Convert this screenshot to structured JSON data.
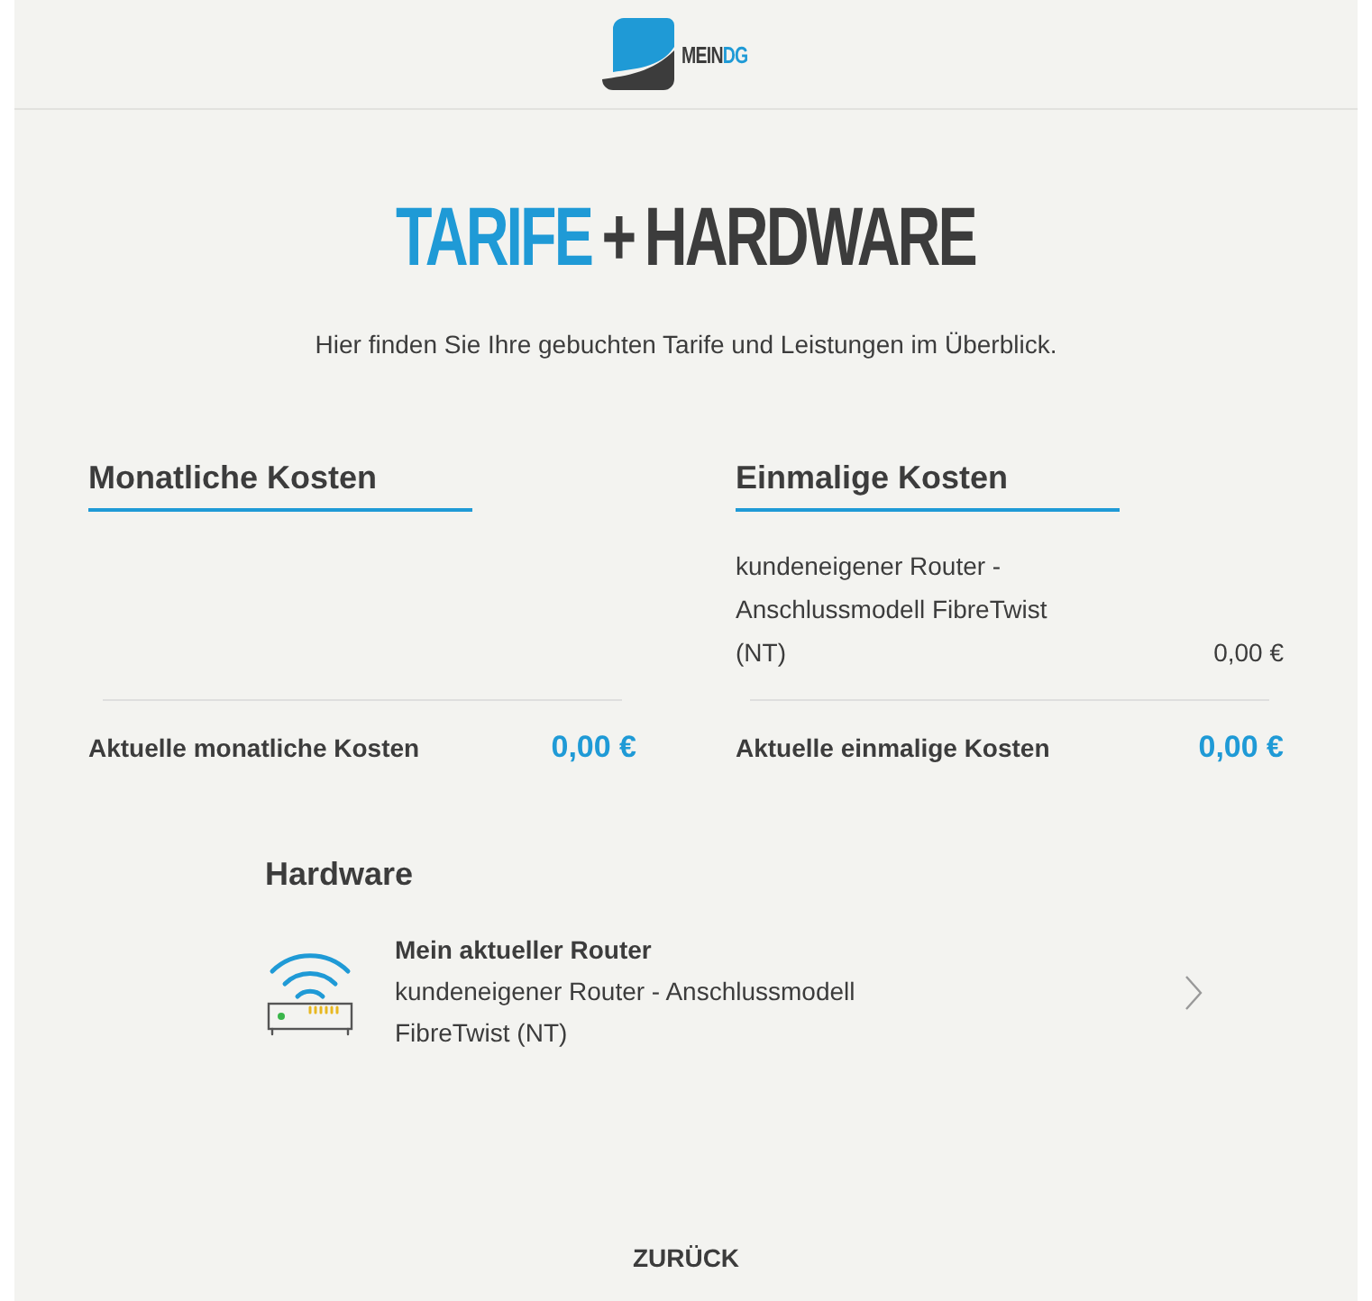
{
  "logo": {
    "parts": [
      {
        "text": "MEIN",
        "highlight": false
      },
      {
        "text": "DG",
        "highlight": true
      }
    ]
  },
  "title": {
    "parts": [
      {
        "text": "TARIFE",
        "highlight": true
      },
      {
        "text": "+",
        "highlight": false
      },
      {
        "text": "HARDWARE",
        "highlight": false
      }
    ]
  },
  "intro": "Hier finden Sie Ihre gebuchten Tarife und Leistungen im Überblick.",
  "cost_sections": [
    {
      "heading": "Monatliche Kosten",
      "total_label": "Aktuelle monatliche Kosten",
      "total": "0,00 €"
    },
    {
      "heading": "Einmalige Kosten",
      "items": [
        {
          "name": "kundeneigener Router - Anschlussmodell FibreTwist (NT)",
          "price": "0,00 €"
        }
      ],
      "total_label": "Aktuelle einmalige Kosten",
      "total": "0,00 €"
    }
  ],
  "hardware": {
    "heading": "Hardware",
    "items": [
      {
        "title": "Mein aktueller Router",
        "description": "kundeneigener Router - Anschlussmodell FibreTwist (NT)"
      }
    ]
  },
  "back_button": "ZURÜCK"
}
